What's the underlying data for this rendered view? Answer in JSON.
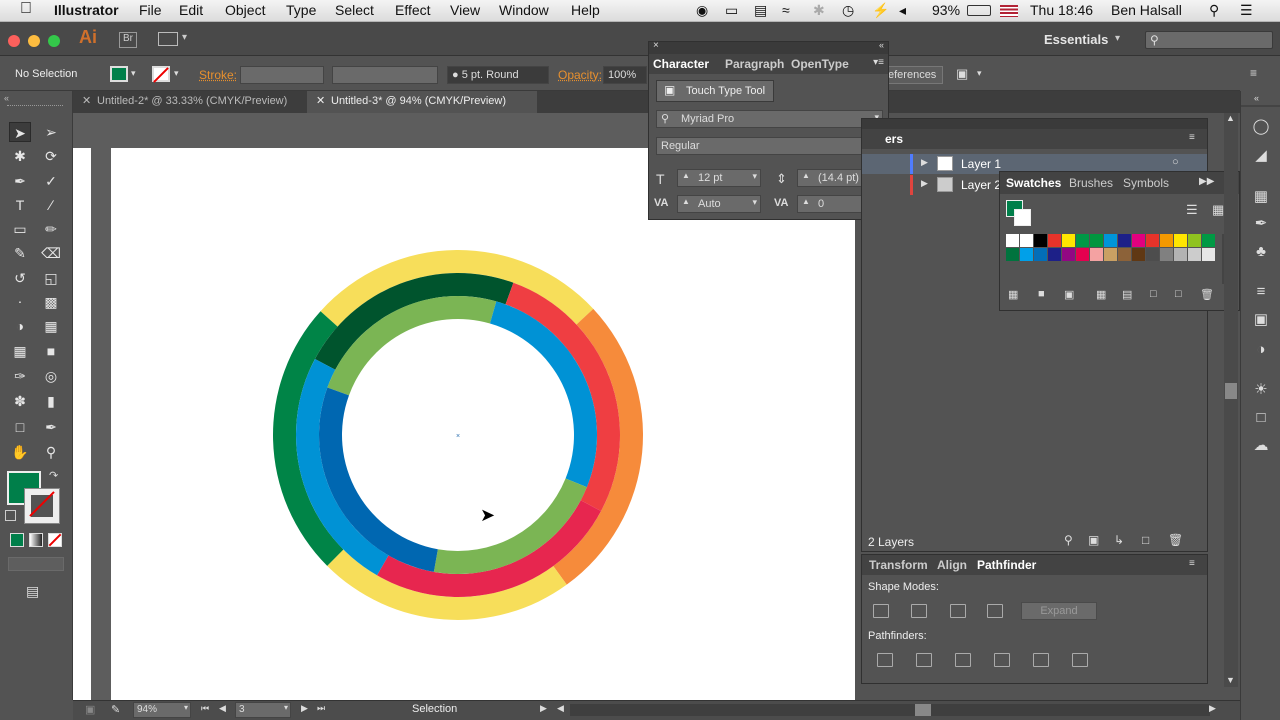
{
  "menubar": {
    "app": "Illustrator",
    "items": [
      "File",
      "Edit",
      "Object",
      "Type",
      "Select",
      "Effect",
      "View",
      "Window",
      "Help"
    ],
    "battery": "93%",
    "clock": "Thu 18:46",
    "user": "Ben Halsall"
  },
  "app": {
    "logo": "Ai",
    "bridge": "Br",
    "workspace": "Essentials"
  },
  "control": {
    "selection": "No Selection",
    "stroke_label": "Stroke:",
    "brush": "5 pt. Round",
    "opacity_label": "Opacity:",
    "opacity": "100%",
    "preferences_partial": "eferences"
  },
  "tabs": [
    {
      "label": "Untitled-2* @ 33.33% (CMYK/Preview)"
    },
    {
      "label": "Untitled-3* @ 94% (CMYK/Preview)"
    }
  ],
  "character": {
    "tabs": [
      "Character",
      "Paragraph",
      "OpenType"
    ],
    "touch_type": "Touch Type Tool",
    "font": "Myriad Pro",
    "style": "Regular",
    "size": "12 pt",
    "leading": "(14.4 pt)",
    "kerning": "Auto",
    "tracking": "0"
  },
  "layers": {
    "title_partial": "ers",
    "items": [
      "Layer 1",
      "Layer 2"
    ],
    "count": "2 Layers"
  },
  "swatches": {
    "tabs": [
      "Swatches",
      "Brushes",
      "Symbols"
    ],
    "colors": [
      "#ffffff",
      "#ffffff",
      "#000000",
      "#e6332a",
      "#ffe600",
      "#009846",
      "#00963f",
      "#0095d9",
      "#1d2088",
      "#e3007f",
      "#e6332a",
      "#f39800",
      "#ffe600",
      "#8fc31f",
      "#009944",
      "#00733e",
      "#00a0e9",
      "#036eb8",
      "#1d2088",
      "#920783",
      "#e5004f",
      "#f4a2a2",
      "#c9a063",
      "#8c6239",
      "#603813",
      "#4d4d4d",
      "#808080",
      "#b3b3b3",
      "#cccccc",
      "#e6e6e6"
    ]
  },
  "properties": {
    "tabs": [
      "Transform",
      "Align",
      "Pathfinder"
    ],
    "shape_modes": "Shape Modes:",
    "expand": "Expand",
    "pathfinders": "Pathfinders:"
  },
  "status": {
    "zoom": "94%",
    "artboard": "3",
    "tool": "Selection"
  },
  "colors": {
    "ring_yellow": "#f7de5a",
    "ring_orange": "#f68b3b",
    "ring_darkgreen": "#008447",
    "ring_deepgreen": "#00542d",
    "ring_red": "#ef3e42",
    "ring_blue": "#0092d5",
    "ring_navy": "#0067b1",
    "ring_lime": "#7bb554",
    "ring_crimson": "#e7264f",
    "fill_swatch": "#007f4a"
  }
}
